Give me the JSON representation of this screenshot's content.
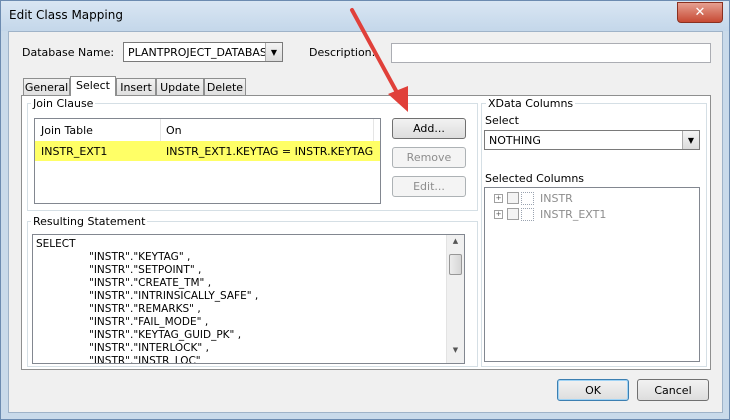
{
  "window": {
    "title": "Edit Class Mapping",
    "close_glyph": "✕"
  },
  "header": {
    "database_label": "Database Name:",
    "database_value": "PLANTPROJECT_DATABAS",
    "description_label": "Description:",
    "description_value": ""
  },
  "tabs": [
    {
      "label": "General",
      "active": false
    },
    {
      "label": "Select",
      "active": true
    },
    {
      "label": "Insert",
      "active": false
    },
    {
      "label": "Update",
      "active": false
    },
    {
      "label": "Delete",
      "active": false
    }
  ],
  "join_clause": {
    "label": "Join Clause",
    "columns": [
      "Join Table",
      "On"
    ],
    "rows": [
      {
        "join_table": "INSTR_EXT1",
        "on": "INSTR_EXT1.KEYTAG = INSTR.KEYTAG"
      }
    ],
    "add_label": "Add...",
    "remove_label": "Remove",
    "edit_label": "Edit..."
  },
  "resulting_statement": {
    "label": "Resulting Statement",
    "lines": [
      "SELECT",
      "\"INSTR\".\"KEYTAG\" ,",
      "\"INSTR\".\"SETPOINT\" ,",
      "\"INSTR\".\"CREATE_TM\" ,",
      "\"INSTR\".\"INTRINSICALLY_SAFE\" ,",
      "\"INSTR\".\"REMARKS\" ,",
      "\"INSTR\".\"FAIL_MODE\" ,",
      "\"INSTR\".\"KEYTAG_GUID_PK\" ,",
      "\"INSTR\".\"INTERLOCK\" ,",
      "\"INSTR\".\"INSTR_LOC\""
    ]
  },
  "xdata": {
    "label": "XData Columns",
    "select_label": "Select",
    "select_value": "NOTHING",
    "selected_columns_label": "Selected Columns",
    "tree_items": [
      "INSTR",
      "INSTR_EXT1"
    ]
  },
  "footer": {
    "ok_label": "OK",
    "cancel_label": "Cancel"
  },
  "colors": {
    "highlight_row": "#ffff66",
    "annotation_arrow": "#e0403a"
  }
}
